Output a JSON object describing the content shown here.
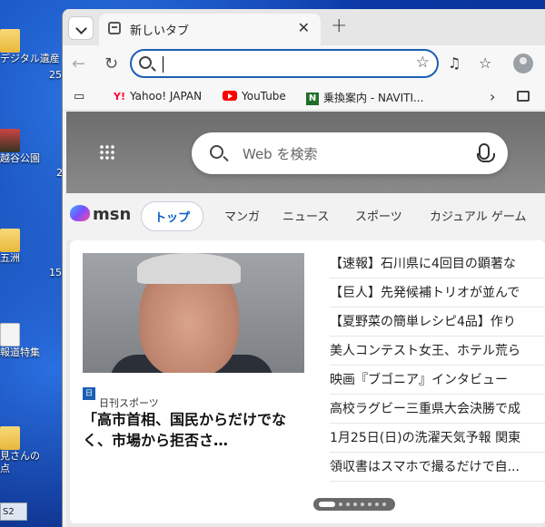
{
  "desktop": {
    "icons": [
      {
        "label": "デジタル遺産",
        "suffix": "25",
        "kind": "folder"
      },
      {
        "label": "越谷公園",
        "suffix": "2",
        "kind": "photo"
      },
      {
        "label": "五洲",
        "suffix": "15",
        "kind": "folder"
      },
      {
        "label": "報道特集",
        "suffix": "",
        "kind": "doc"
      },
      {
        "label": "見さんの",
        "suffix": "",
        "kind": "folder"
      },
      {
        "label": "点",
        "suffix": "",
        "kind": "none"
      }
    ],
    "taskbar_chip": "S2"
  },
  "browser": {
    "tab": {
      "title": "新しいタブ"
    },
    "new_tab_symbol": "+",
    "address": {
      "value": ""
    },
    "bookmarks": [
      {
        "label": "Yahoo! JAPAN",
        "icon": "yahoo-icon"
      },
      {
        "label": "YouTube",
        "icon": "youtube-icon"
      },
      {
        "label": "乗換案内 - NAVITI...",
        "icon": "navitime-icon"
      }
    ]
  },
  "newtab": {
    "search_placeholder": "Web を検索",
    "msn_label": "msn",
    "nav_tabs": [
      "トップ",
      "マンガ",
      "ニュース",
      "スポーツ",
      "カジュアル ゲーム"
    ],
    "lead_story": {
      "source": "日刊スポーツ",
      "source_badge": "日刊",
      "headline": "「高市首相、国民からだけでなく、市場から拒否さ…"
    },
    "headlines": [
      "【速報】石川県に4回目の顕著な",
      "【巨人】先発候補トリオが並んで",
      "【夏野菜の簡単レシピ4品】作り",
      "美人コンテスト女王、ホテル荒ら",
      "映画『ブゴニア』インタビュー",
      "高校ラグビー三重県大会決勝で成",
      "1月25日(日)の洗濯天気予報 関東",
      "領収書はスマホで撮るだけで自..."
    ],
    "pager": {
      "pages": 8,
      "current": 1
    }
  }
}
